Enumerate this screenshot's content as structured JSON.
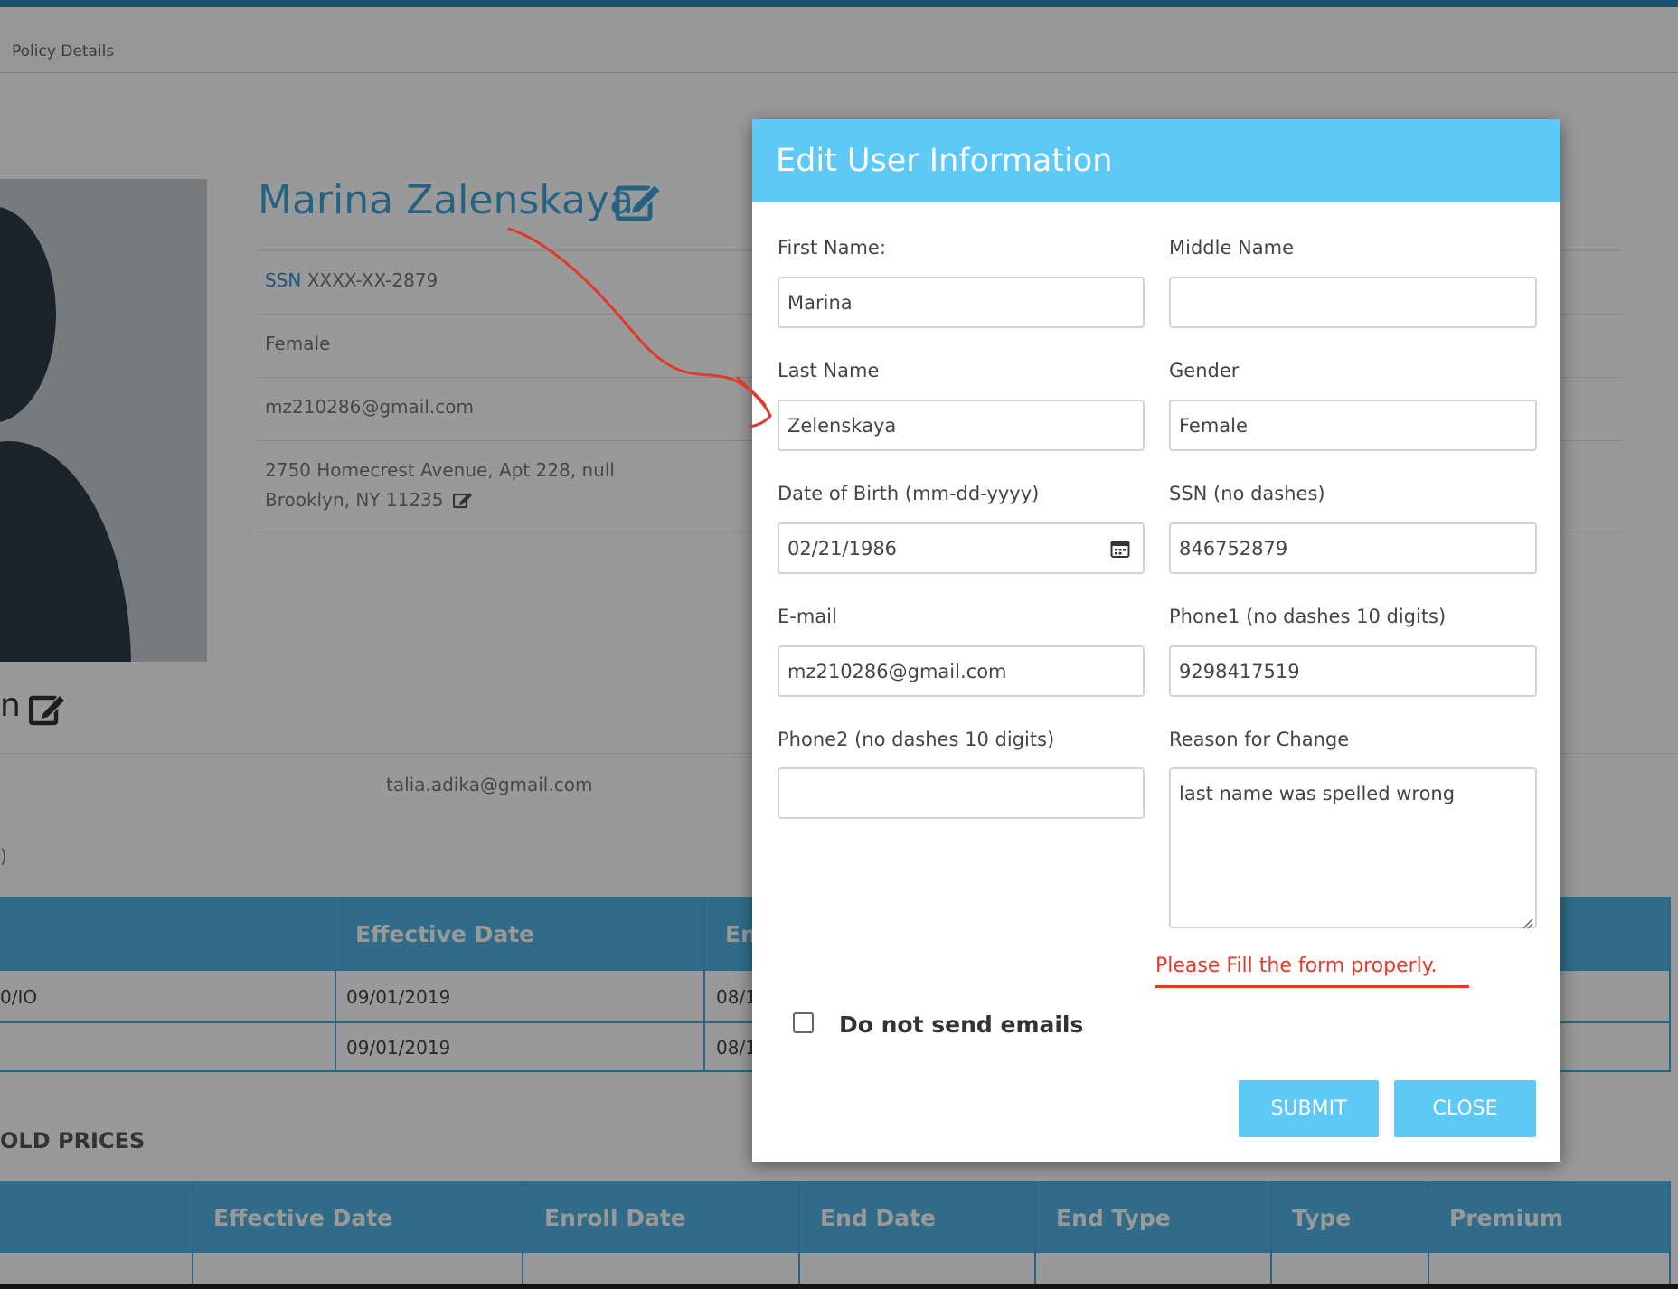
{
  "breadcrumb": "Policy Details",
  "profile": {
    "name": "Marina Zalenskaya",
    "ssn_label": "SSN",
    "ssn_value": "XXXX-XX-2879",
    "gender": "Female",
    "email": "mz210286@gmail.com",
    "address_line1": "2750 Homecrest Avenue, Apt 228, null",
    "address_line2": "Brooklyn, NY 11235"
  },
  "contact": {
    "partial_name": "n",
    "email": "talia.adika@gmail.com",
    "partial_paren": ")"
  },
  "table1": {
    "headers": [
      "",
      "Effective Date",
      "En"
    ],
    "rows": [
      [
        "0/IO",
        "09/01/2019",
        "08/1"
      ],
      [
        "",
        "09/01/2019",
        "08/1"
      ]
    ]
  },
  "section2": {
    "title": "OLD PRICES",
    "headers": [
      "",
      "Effective Date",
      "Enroll Date",
      "End Date",
      "End Type",
      "Type",
      "Premium"
    ]
  },
  "modal": {
    "title": "Edit User Information",
    "first_name_label": "First Name:",
    "first_name_value": "Marina",
    "middle_name_label": "Middle Name",
    "middle_name_value": "",
    "last_name_label": "Last Name",
    "last_name_value": "Zelenskaya",
    "gender_label": "Gender",
    "gender_value": "Female",
    "dob_label": "Date of Birth (mm-dd-yyyy)",
    "dob_value": "02/21/1986",
    "ssn_label": "SSN (no dashes)",
    "ssn_value": "846752879",
    "email_label": "E-mail",
    "email_value": "mz210286@gmail.com",
    "phone1_label": "Phone1 (no dashes 10 digits)",
    "phone1_value": "9298417519",
    "phone2_label": "Phone2 (no dashes 10 digits)",
    "phone2_value": "",
    "reason_label": "Reason for Change",
    "reason_value": "last name was spelled wrong",
    "error_message": "Please Fill the form properly.",
    "no_emails_label": "Do not send emails",
    "no_emails_checked": false,
    "submit_label": "SUBMIT",
    "close_label": "CLOSE"
  },
  "colors": {
    "modal_header": "#5ec8f6",
    "button": "#5ec8f6",
    "error": "#e23a2a",
    "name_link": "#3ca4d8",
    "table_header": "#50b4e4"
  }
}
